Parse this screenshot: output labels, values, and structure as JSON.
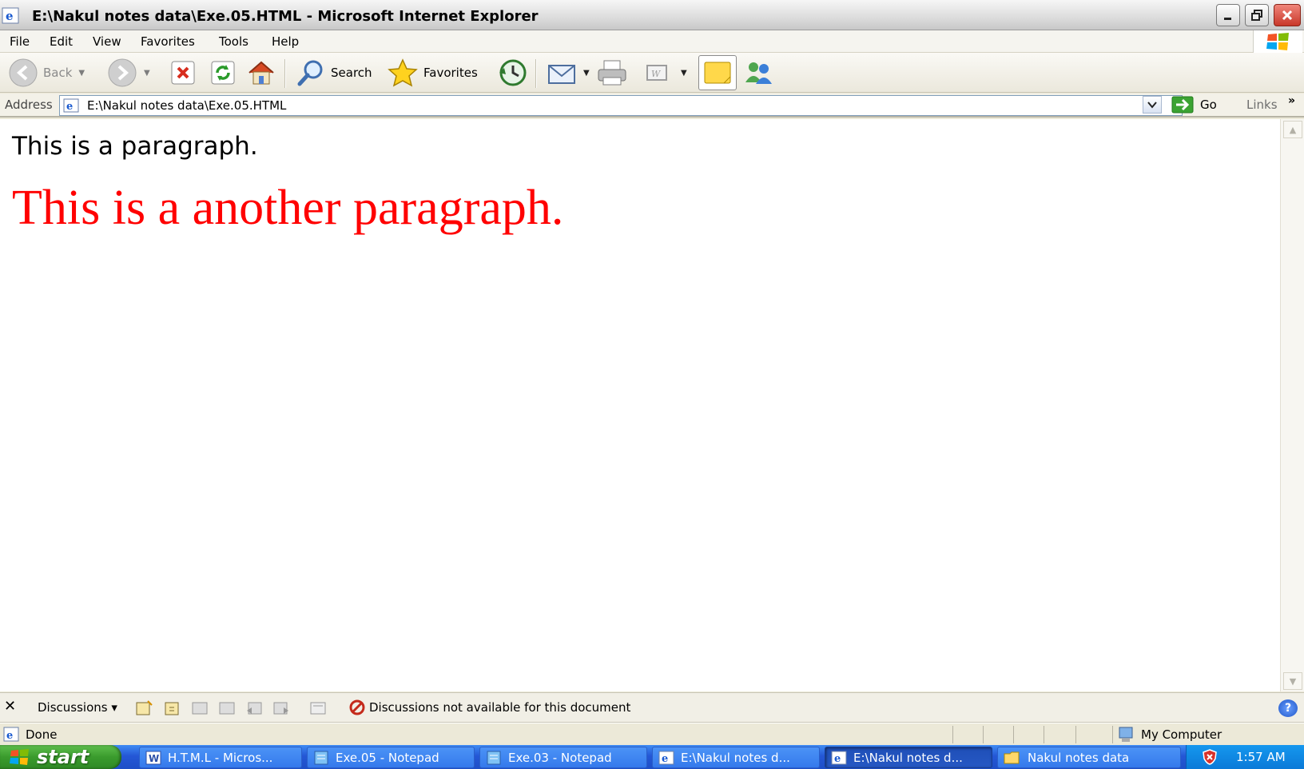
{
  "window": {
    "title": "E:\\Nakul notes data\\Exe.05.HTML - Microsoft Internet Explorer"
  },
  "menu": {
    "items": [
      "File",
      "Edit",
      "View",
      "Favorites",
      "Tools",
      "Help"
    ]
  },
  "toolbar": {
    "back_label": "Back",
    "search_label": "Search",
    "favorites_label": "Favorites"
  },
  "address": {
    "label": "Address",
    "value": "E:\\Nakul notes data\\Exe.05.HTML",
    "go_label": "Go",
    "links_label": "Links"
  },
  "content": {
    "paragraph1": "This is a paragraph.",
    "paragraph2": "This is a another paragraph.",
    "paragraph2_color": "#ff0000"
  },
  "discussions": {
    "label": "Discussions",
    "message": "Discussions not available for this document"
  },
  "status": {
    "text": "Done",
    "zone": "My Computer"
  },
  "taskbar": {
    "start_label": "start",
    "tasks": [
      {
        "label": "H.T.M.L - Micros...",
        "icon": "word-icon"
      },
      {
        "label": "Exe.05 - Notepad",
        "icon": "notepad-icon"
      },
      {
        "label": "Exe.03 - Notepad",
        "icon": "notepad-icon"
      },
      {
        "label": "E:\\Nakul notes d...",
        "icon": "ie-icon"
      },
      {
        "label": "E:\\Nakul notes d...",
        "icon": "ie-icon"
      },
      {
        "label": "Nakul notes data",
        "icon": "folder-icon"
      }
    ],
    "clock": "1:57 AM"
  }
}
